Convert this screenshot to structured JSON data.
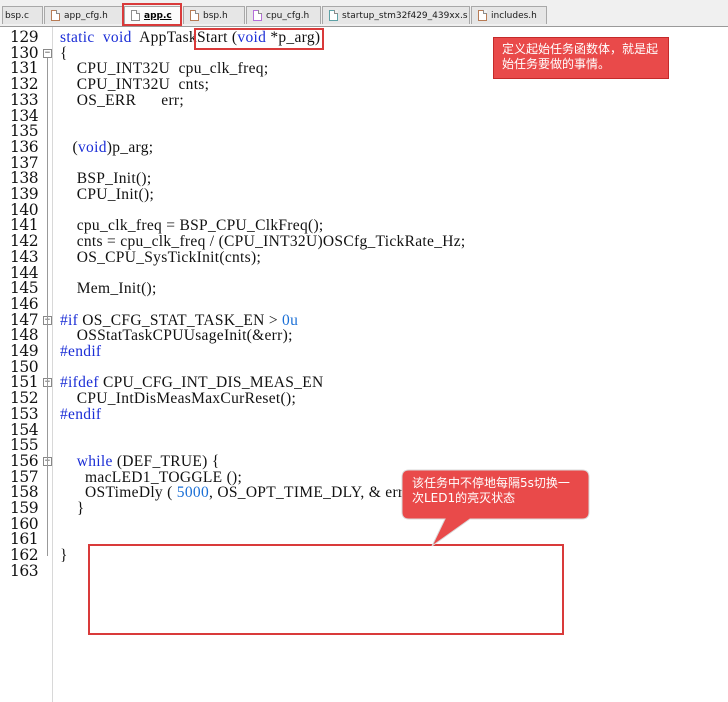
{
  "tabs": [
    {
      "label": "bsp.c",
      "icon": "none"
    },
    {
      "label": "app_cfg.h",
      "icon": "header-file-icon"
    },
    {
      "label": "app.c",
      "icon": "c-file-icon",
      "active": true
    },
    {
      "label": "bsp.h",
      "icon": "header-file-icon"
    },
    {
      "label": "cpu_cfg.h",
      "icon": "header-file-icon"
    },
    {
      "label": "startup_stm32f429_439xx.s",
      "icon": "asm-file-icon"
    },
    {
      "label": "includes.h",
      "icon": "header-file-icon"
    }
  ],
  "editor": {
    "lines": [
      {
        "num": "129",
        "code": "static  void  AppTaskStart (void *p_arg)"
      },
      {
        "num": "130",
        "code": "{"
      },
      {
        "num": "131",
        "code": "    CPU_INT32U  cpu_clk_freq;"
      },
      {
        "num": "132",
        "code": "    CPU_INT32U  cnts;"
      },
      {
        "num": "133",
        "code": "    OS_ERR      err;"
      },
      {
        "num": "134",
        "code": ""
      },
      {
        "num": "135",
        "code": ""
      },
      {
        "num": "136",
        "code": "   (void)p_arg;"
      },
      {
        "num": "137",
        "code": ""
      },
      {
        "num": "138",
        "code": "    BSP_Init();"
      },
      {
        "num": "139",
        "code": "    CPU_Init();"
      },
      {
        "num": "140",
        "code": ""
      },
      {
        "num": "141",
        "code": "    cpu_clk_freq = BSP_CPU_ClkFreq();"
      },
      {
        "num": "142",
        "code": "    cnts = cpu_clk_freq / (CPU_INT32U)OSCfg_TickRate_Hz;"
      },
      {
        "num": "143",
        "code": "    OS_CPU_SysTickInit(cnts);"
      },
      {
        "num": "144",
        "code": ""
      },
      {
        "num": "145",
        "code": "    Mem_Init();"
      },
      {
        "num": "146",
        "code": ""
      },
      {
        "num": "147",
        "code": "#if OS_CFG_STAT_TASK_EN > 0u"
      },
      {
        "num": "148",
        "code": "    OSStatTaskCPUUsageInit(&err);"
      },
      {
        "num": "149",
        "code": "#endif"
      },
      {
        "num": "150",
        "code": ""
      },
      {
        "num": "151",
        "code": "#ifdef CPU_CFG_INT_DIS_MEAS_EN"
      },
      {
        "num": "152",
        "code": "    CPU_IntDisMeasMaxCurReset();"
      },
      {
        "num": "153",
        "code": "#endif"
      },
      {
        "num": "154",
        "code": ""
      },
      {
        "num": "155",
        "code": ""
      },
      {
        "num": "156",
        "code": "    while (DEF_TRUE) {"
      },
      {
        "num": "157",
        "code": "      macLED1_TOGGLE ();"
      },
      {
        "num": "158",
        "code": "      OSTimeDly ( 5000, OS_OPT_TIME_DLY, & err );"
      },
      {
        "num": "159",
        "code": "    }"
      },
      {
        "num": "160",
        "code": ""
      },
      {
        "num": "161",
        "code": ""
      },
      {
        "num": "162",
        "code": "}"
      },
      {
        "num": "163",
        "code": ""
      }
    ]
  },
  "annotations": {
    "callout_top": "定义起始任务函数体，就是起始任务要做的事情。",
    "callout_bottom": "该任务中不停地每隔5s切换一次LED1的亮灭状态"
  },
  "colors": {
    "keyword": "#1a2dd6",
    "annotation": "#d93a3a",
    "callout_fill": "#e94a4a"
  }
}
